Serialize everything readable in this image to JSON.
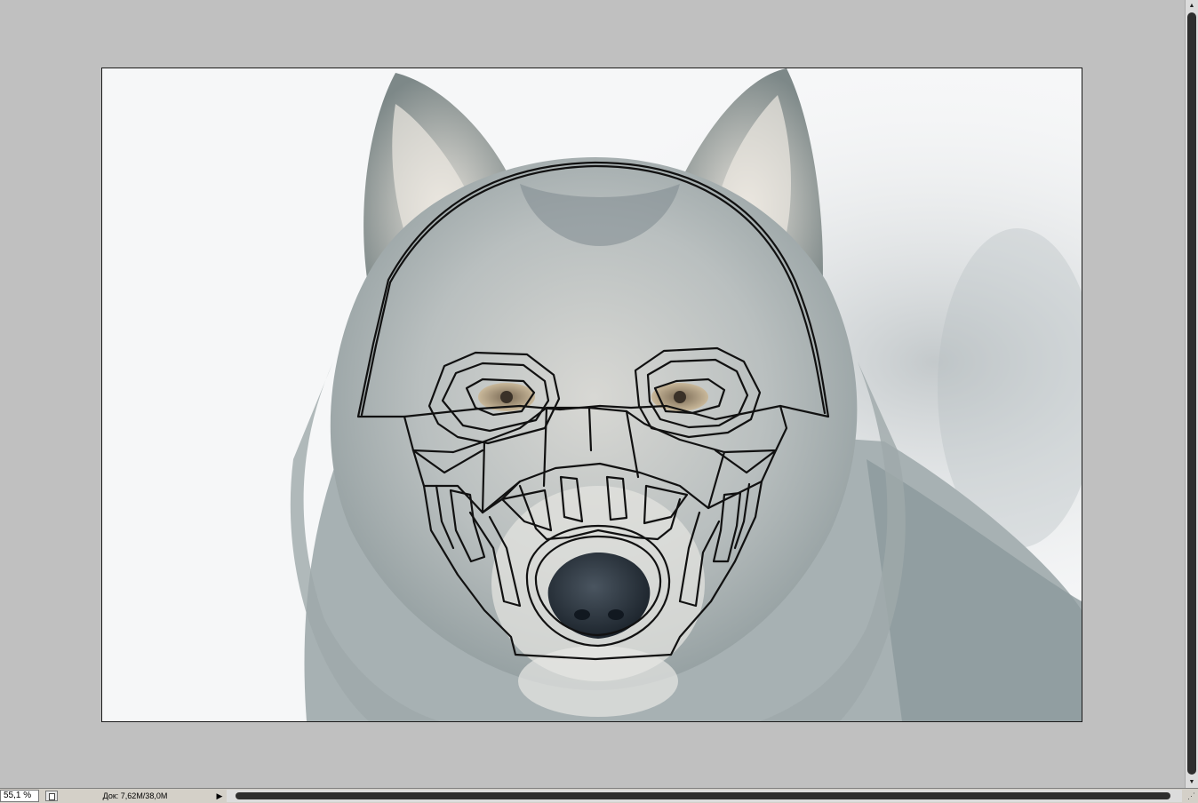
{
  "status_bar": {
    "zoom_value": "55,1 %",
    "doc_info": "Док: 7,62M/38,0M",
    "menu_arrow": "▶"
  },
  "icons": {
    "page_icon": "page-icon",
    "status_menu_arrow": "triangle-right-icon",
    "scroll_up": "▲",
    "scroll_down": "▼",
    "resize_grip": "⋰"
  },
  "document": {
    "image_subject": "wolf photo with mask sketch overlay"
  },
  "colors": {
    "workspace_bg": "#c0c0c0",
    "status_bar_bg": "#d4d0c8",
    "scroll_thumb": "#2e2e2e"
  }
}
